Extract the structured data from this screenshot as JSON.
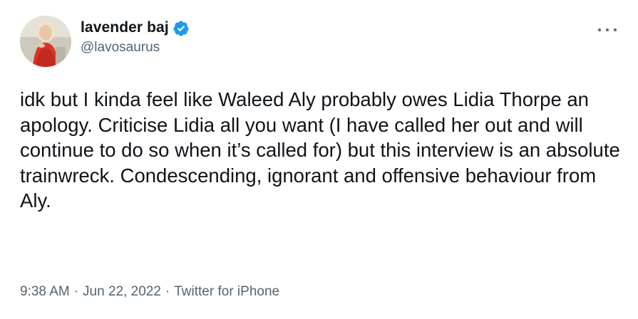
{
  "user": {
    "display_name": "lavender baj",
    "handle": "@lavosaurus",
    "verified": true,
    "verified_color": "#1d9bf0"
  },
  "tweet": {
    "text": "idk but I kinda feel like Waleed Aly probably owes Lidia Thorpe an apology. Criticise Lidia all you want (I have called her out and will continue to do so when it’s called for) but this interview is an absolute trainwreck. Condescending, ignorant and offensive behaviour from Aly."
  },
  "meta": {
    "time": "9:38 AM",
    "separator": "·",
    "date": "Jun 22, 2022",
    "source": "Twitter for iPhone"
  },
  "icons": {
    "more": "more-horizontal-icon",
    "verified": "verified-badge-icon"
  },
  "colors": {
    "text": "#0f1419",
    "secondary": "#536471",
    "accent": "#1d9bf0"
  }
}
